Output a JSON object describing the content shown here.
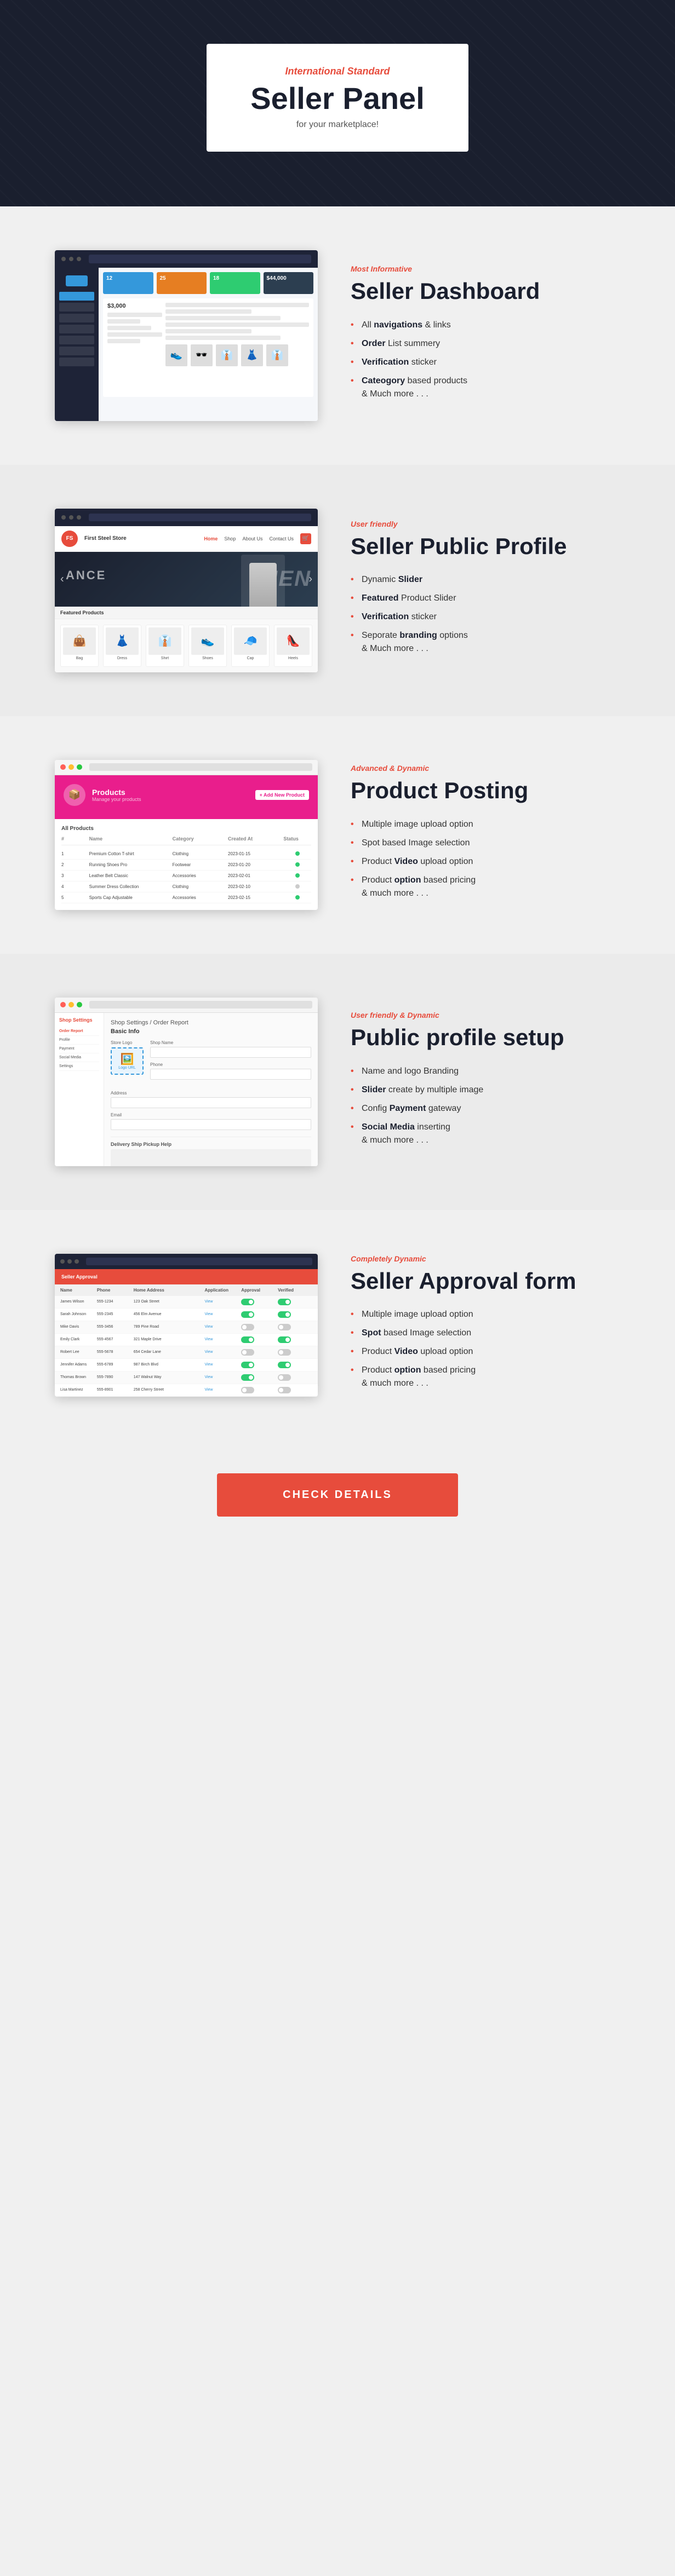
{
  "hero": {
    "subtitle": "International Standard",
    "title": "Seller Panel",
    "description": "for your marketplace!"
  },
  "sections": [
    {
      "id": "dashboard",
      "tag": "Most Informative",
      "title": "Seller Dashboard",
      "position": "right",
      "features": [
        {
          "text": "All ",
          "bold": "navigations",
          "rest": " & links"
        },
        {
          "text": "",
          "bold": "Order",
          "rest": " List summery"
        },
        {
          "text": "",
          "bold": "Verification",
          "rest": " sticker"
        },
        {
          "text": "",
          "bold": "Cateogory",
          "rest": " based products"
        },
        {
          "text": "& Much more . . .",
          "bold": "",
          "rest": ""
        }
      ]
    },
    {
      "id": "profile",
      "tag": "User friendly",
      "title": "Seller Public Profile",
      "position": "left",
      "features": [
        {
          "text": "Dynamic ",
          "bold": "Slider",
          "rest": ""
        },
        {
          "text": "",
          "bold": "Featured",
          "rest": " Product Slider"
        },
        {
          "text": "",
          "bold": "Verification",
          "rest": " sticker"
        },
        {
          "text": "Seporate ",
          "bold": "branding",
          "rest": " options"
        },
        {
          "text": "& Much more . . .",
          "bold": "",
          "rest": ""
        }
      ]
    },
    {
      "id": "product-posting",
      "tag": "Advanced & Dynamic",
      "title": "Product Posting",
      "position": "right",
      "features": [
        {
          "text": "Multiple image upload option",
          "bold": "",
          "rest": ""
        },
        {
          "text": "Spot based Image selection",
          "bold": "",
          "rest": ""
        },
        {
          "text": "Product ",
          "bold": "Video",
          "rest": " upload option"
        },
        {
          "text": "Product ",
          "bold": "option",
          "rest": " based pricing"
        },
        {
          "text": "& much more . . .",
          "bold": "",
          "rest": ""
        }
      ]
    },
    {
      "id": "public-setup",
      "tag": "User friendly & Dynamic",
      "title": "Public profile setup",
      "position": "left",
      "features": [
        {
          "text": "Name and logo Branding",
          "bold": "",
          "rest": ""
        },
        {
          "text": "",
          "bold": "Slider",
          "rest": " create by multiple image"
        },
        {
          "text": "Config ",
          "bold": "Payment",
          "rest": " gateway"
        },
        {
          "text": "",
          "bold": "Social Media",
          "rest": " inserting"
        },
        {
          "text": "& much more . . .",
          "bold": "",
          "rest": ""
        }
      ]
    },
    {
      "id": "approval",
      "tag": "Completely Dynamic",
      "title": "Seller Approval form",
      "position": "right",
      "features": [
        {
          "text": "Multiple image upload option",
          "bold": "",
          "rest": ""
        },
        {
          "text": "",
          "bold": "Spot",
          "rest": " based Image selection"
        },
        {
          "text": "Product ",
          "bold": "Video",
          "rest": " upload option"
        },
        {
          "text": "Product ",
          "bold": "option",
          "rest": " based pricing"
        },
        {
          "text": "& much more . . .",
          "bold": "",
          "rest": ""
        }
      ]
    }
  ],
  "cta": {
    "label": "CHECK DETAILS"
  },
  "dashboard_mock": {
    "stats": [
      "12",
      "25",
      "18",
      "$44,000"
    ],
    "product_emojis": [
      "👟",
      "🕶️",
      "👔",
      "👗",
      "👔"
    ]
  },
  "profile_mock": {
    "banner_text": "MEN",
    "store_name": "First Steel Store",
    "nav_items": [
      "Home",
      "Shop",
      "About Us",
      "Contact Us"
    ]
  },
  "product_mock": {
    "header_title": "Products",
    "add_btn": "Add New Product",
    "columns": [
      "#",
      "Name",
      "Category",
      "Created At",
      "Status"
    ],
    "rows": [
      [
        "1",
        "Premium Cotton T-shirt",
        "Clothing",
        "2023-01-15",
        "active"
      ],
      [
        "2",
        "Running Shoes Pro",
        "Footwear",
        "2023-01-20",
        "active"
      ],
      [
        "3",
        "Leather Belt Classic",
        "Accessories",
        "2023-02-01",
        "active"
      ],
      [
        "4",
        "Summer Dress",
        "Clothing",
        "2023-02-10",
        "inactive"
      ],
      [
        "5",
        "Sports Cap",
        "Accessories",
        "2023-02-15",
        "active"
      ]
    ]
  },
  "setup_mock": {
    "sidebar_items": [
      "Shop Settings",
      "Order Report",
      "Profile",
      "Payment",
      "Social Media"
    ],
    "section_title": "Basic Info",
    "fields": [
      "Shop Name",
      "Phone",
      "Address",
      "Email"
    ]
  },
  "approval_mock": {
    "header": "Seller Approval",
    "columns": [
      "Name",
      "Phone",
      "Home Address",
      "Application Form",
      "Approval",
      "Verified"
    ],
    "rows": [
      [
        "James Wilson",
        "555-1234",
        "123 Oak Street",
        "View Form",
        "on",
        "on"
      ],
      [
        "Sarah Johnson",
        "555-2345",
        "456 Elm Avenue",
        "View Form",
        "on",
        "on"
      ],
      [
        "Mike Davis",
        "555-3456",
        "789 Pine Road",
        "View Form",
        "off",
        "off"
      ],
      [
        "Emily Clark",
        "555-4567",
        "321 Maple Drive",
        "View Form",
        "on",
        "on"
      ],
      [
        "Robert Lee",
        "555-5678",
        "654 Cedar Lane",
        "View Form",
        "off",
        "off"
      ],
      [
        "Jennifer Adams",
        "555-6789",
        "987 Birch Blvd",
        "View Form",
        "on",
        "on"
      ],
      [
        "Thomas Brown",
        "555-7890",
        "147 Walnut Way",
        "View Form",
        "on",
        "off"
      ],
      [
        "Lisa Martinez",
        "555-8901",
        "258 Cherry Street",
        "View Form",
        "off",
        "off"
      ]
    ]
  }
}
